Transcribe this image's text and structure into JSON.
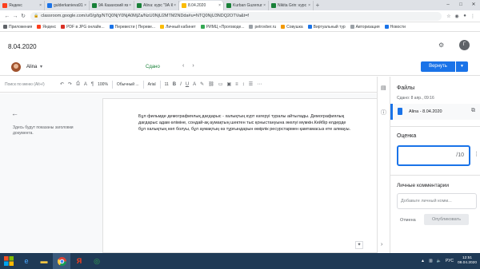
{
  "browser": {
    "tabs": [
      {
        "label": "Яндекс",
        "color": "#fc3f1d"
      },
      {
        "label": "gulderkanieva91@...",
        "color": "#1a73e8"
      },
      {
        "label": "9А Казахский язы...",
        "color": "#188038"
      },
      {
        "label": "Alina: курс \"9А Ка...",
        "color": "#188038"
      },
      {
        "label": "8.04.2020",
        "color": "#fbbc04",
        "active": true
      },
      {
        "label": "Kurban Guzenur...",
        "color": "#188038"
      },
      {
        "label": "Nikita Grin: курс ...",
        "color": "#188038"
      }
    ],
    "url": "classroom.google.com/u/0/g/tg/NTQ0NjY0NjA0MjZa/NzU0NjU2MTM2NDda#u=NTQ0NjU3NDQ2OTVa&t=f",
    "bookmarks": [
      {
        "label": "Приложения",
        "color": "#5f6368"
      },
      {
        "label": "Яндекс",
        "color": "#fc3f1d"
      },
      {
        "label": "PDF в JPG онлайн...",
        "color": "#d93025"
      },
      {
        "label": "Перевести | Переве...",
        "color": "#1a73e8"
      },
      {
        "label": "Личный кабинет",
        "color": "#fbbc04"
      },
      {
        "label": "РИМЦ «Проговоде...",
        "color": "#34a853"
      },
      {
        "label": "petrovber.ru",
        "color": "#9aa0a6"
      },
      {
        "label": "Совушка",
        "color": "#f29900"
      },
      {
        "label": "Виртуальный тур",
        "color": "#1a73e8"
      },
      {
        "label": "Авторизация",
        "color": "#9aa0a6"
      },
      {
        "label": "Новости",
        "color": "#1a73e8"
      }
    ]
  },
  "classroom": {
    "title": "8.04.2020",
    "user_initial": "Г",
    "student_name": "Alina",
    "status": "Сдано",
    "return_label": "Вернуть"
  },
  "toolbar": {
    "search_placeholder": "Поиск по меню (Alt+/)",
    "zoom": "100%",
    "style": "Обычный ...",
    "font": "Arial",
    "size": "11"
  },
  "document": {
    "outline_hint": "Здесь будут показаны заголовки документа.",
    "body": "Бұл фильмде демографиялық дағдарыс - халықтың күрт өзгеруі туралы айтылады. Демографиялық дағдарыс адам өліміне, сондай-ақ аумақтың шектен тыс қоныстануына әкелуі мүмкін.Кейбір елдерде бұл халықтың көп болуы, бұл аумақтың өз тұрғындарын өмірлік ресурстармен қамтамасыз ете алмауы."
  },
  "panel": {
    "files_title": "Файлы",
    "files_sub": "Сдано: 8 апр., 09:16",
    "file_name": "Alina - 8.04.2020",
    "grade_title": "Оценка",
    "grade_max": "/10",
    "comments_title": "Личные комментарии",
    "comment_placeholder": "Добавьте личный комм...",
    "cancel_label": "Отмена",
    "publish_label": "Опубликовать"
  },
  "taskbar": {
    "lang": "РУС",
    "time": "12:51",
    "date": "08.04.2020"
  }
}
